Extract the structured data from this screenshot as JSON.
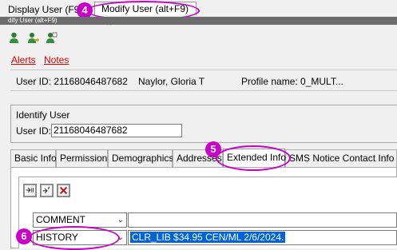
{
  "window": {
    "tab_display": "Display User (F9)",
    "tab_modify": "Modify User (alt+F9)",
    "tab_modify_close": "✕",
    "sub_title": "dify User (alt+F9)"
  },
  "annotations": {
    "step4": "4",
    "step5": "5",
    "step6": "6"
  },
  "toolbar": {
    "icons": [
      "user-green-icon",
      "user-key-icon",
      "user-badge-icon"
    ]
  },
  "links": {
    "alerts": "Alerts",
    "notes": "Notes"
  },
  "summary": {
    "user_id": "User ID: 21168046487682",
    "name": "Naylor, Gloria T",
    "profile": "Profile name: 0_MULT..."
  },
  "identify": {
    "title": "Identify User",
    "label": "User ID:",
    "value": "21168046487682"
  },
  "tabs": [
    "Basic Info",
    "Permission",
    "Demographics",
    "Addresses",
    "Extended Info",
    "SMS Notice Contact Info"
  ],
  "panel": {
    "buttons": [
      "add-row-icon",
      "insert-row-icon",
      "delete-row-icon"
    ],
    "rows": [
      {
        "type": "COMMENT",
        "value": ""
      },
      {
        "type": "HISTORY",
        "value": "CLR_LIB $34.95 CEN/ML 2/6/2024."
      }
    ]
  },
  "colors": {
    "annotation": "#c800c8",
    "selection": "#0064d2",
    "link": "#e00000"
  }
}
